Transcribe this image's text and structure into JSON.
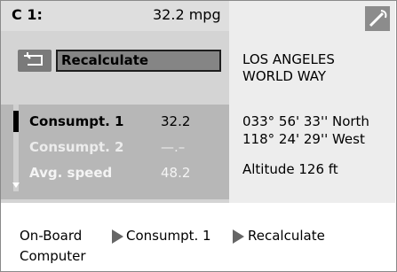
{
  "c1": {
    "label": "C 1:",
    "value": "32.2 mpg"
  },
  "recalc": {
    "label": "Recalculate",
    "back_icon": "back-arrow-icon"
  },
  "menu": {
    "items": [
      {
        "label": "Consumpt. 1",
        "value": "32.2",
        "selected": true
      },
      {
        "label": "Consumpt. 2",
        "value": "—.–",
        "selected": false
      },
      {
        "label": "Avg. speed",
        "value": "48.2",
        "selected": false
      }
    ]
  },
  "location": {
    "line1": "LOS ANGELES",
    "line2": "WORLD WAY",
    "latitude": "033° 56' 33'' North",
    "longitude": "118° 24' 29'' West",
    "altitude": "Altitude 126 ft",
    "compass_icon": "compass-icon"
  },
  "breadcrumb": {
    "root_line1": "On-Board",
    "root_line2": "Computer",
    "item1": "Consumpt. 1",
    "item2": "Recalculate"
  },
  "colors": {
    "left_panel": "#d4d4d4",
    "menu_bg": "#b7b7b7",
    "right_panel": "#ededed",
    "recalc_field": "#858585",
    "back_button": "#7a7a7a"
  }
}
